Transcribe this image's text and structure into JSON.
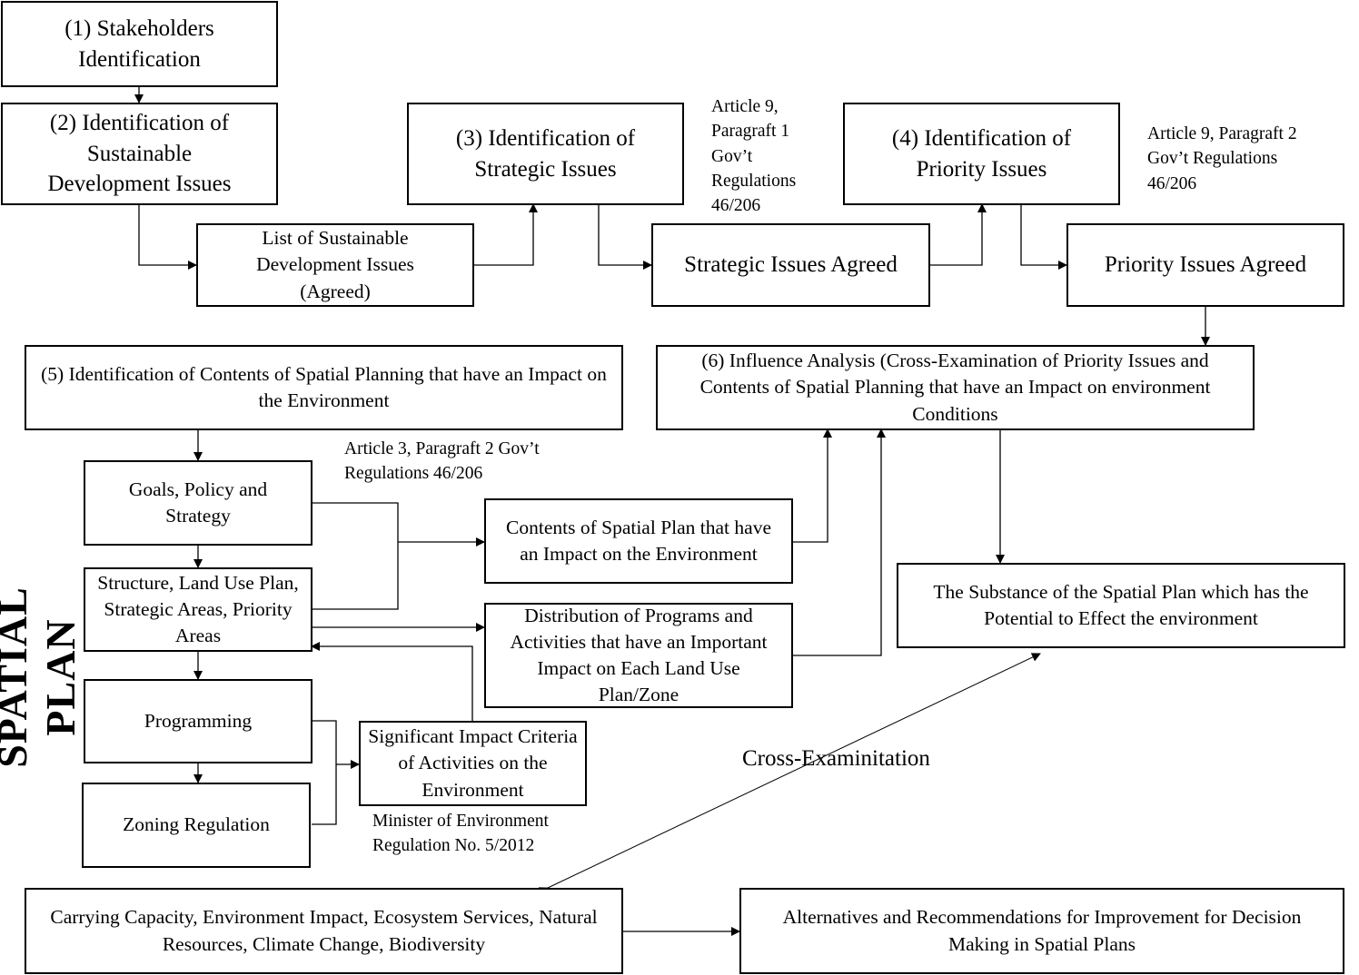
{
  "boxes": {
    "stakeholders": "(1) Stakeholders Identification",
    "sustainable": "(2) Identification of Sustainable Development Issues",
    "strategic": "(3) Identification of Strategic Issues",
    "priority": "(4) Identification of Priority Issues",
    "list_sustainable": "List of Sustainable Development Issues (Agreed)",
    "strategic_agreed": "Strategic Issues Agreed",
    "priority_agreed": "Priority Issues Agreed",
    "contents_identification": "(5) Identification of Contents of Spatial Planning that have an Impact on the Environment",
    "influence": "(6) Influence Analysis (Cross-Examination of Priority Issues and Contents of Spatial Planning that have an Impact on environment Conditions",
    "goals": "Goals, Policy and Strategy",
    "structure": "Structure, Land Use Plan, Strategic Areas, Priority Areas",
    "programming": "Programming",
    "zoning": "Zoning Regulation",
    "contents_plan": "Contents of Spatial Plan that have an Impact on the Environment",
    "distribution": "Distribution of Programs and Activities that have an Important Impact on Each Land Use Plan/Zone",
    "significant": "Significant Impact Criteria of Activities on the Environment",
    "substance": "The Substance of the Spatial Plan which has the Potential to Effect the environment",
    "carrying": "Carrying Capacity, Environment Impact, Ecosystem Services, Natural Resources, Climate Change, Biodiversity",
    "alternatives": "Alternatives and Recommendations for Improvement for Decision Making in Spatial Plans"
  },
  "notes": {
    "art9_p1": "Article 9, Paragraft 1 Gov’t Regulations 46/206",
    "art9_p2": "Article 9, Paragraft 2 Gov’t Regulations 46/206",
    "art3_p2": "Article 3, Paragraft 2 Gov’t Regulations 46/206",
    "minister": "Minister of Environment Regulation No. 5/2012",
    "cross": "Cross-Examinitation"
  },
  "side_label": "SPATIAL PLAN"
}
